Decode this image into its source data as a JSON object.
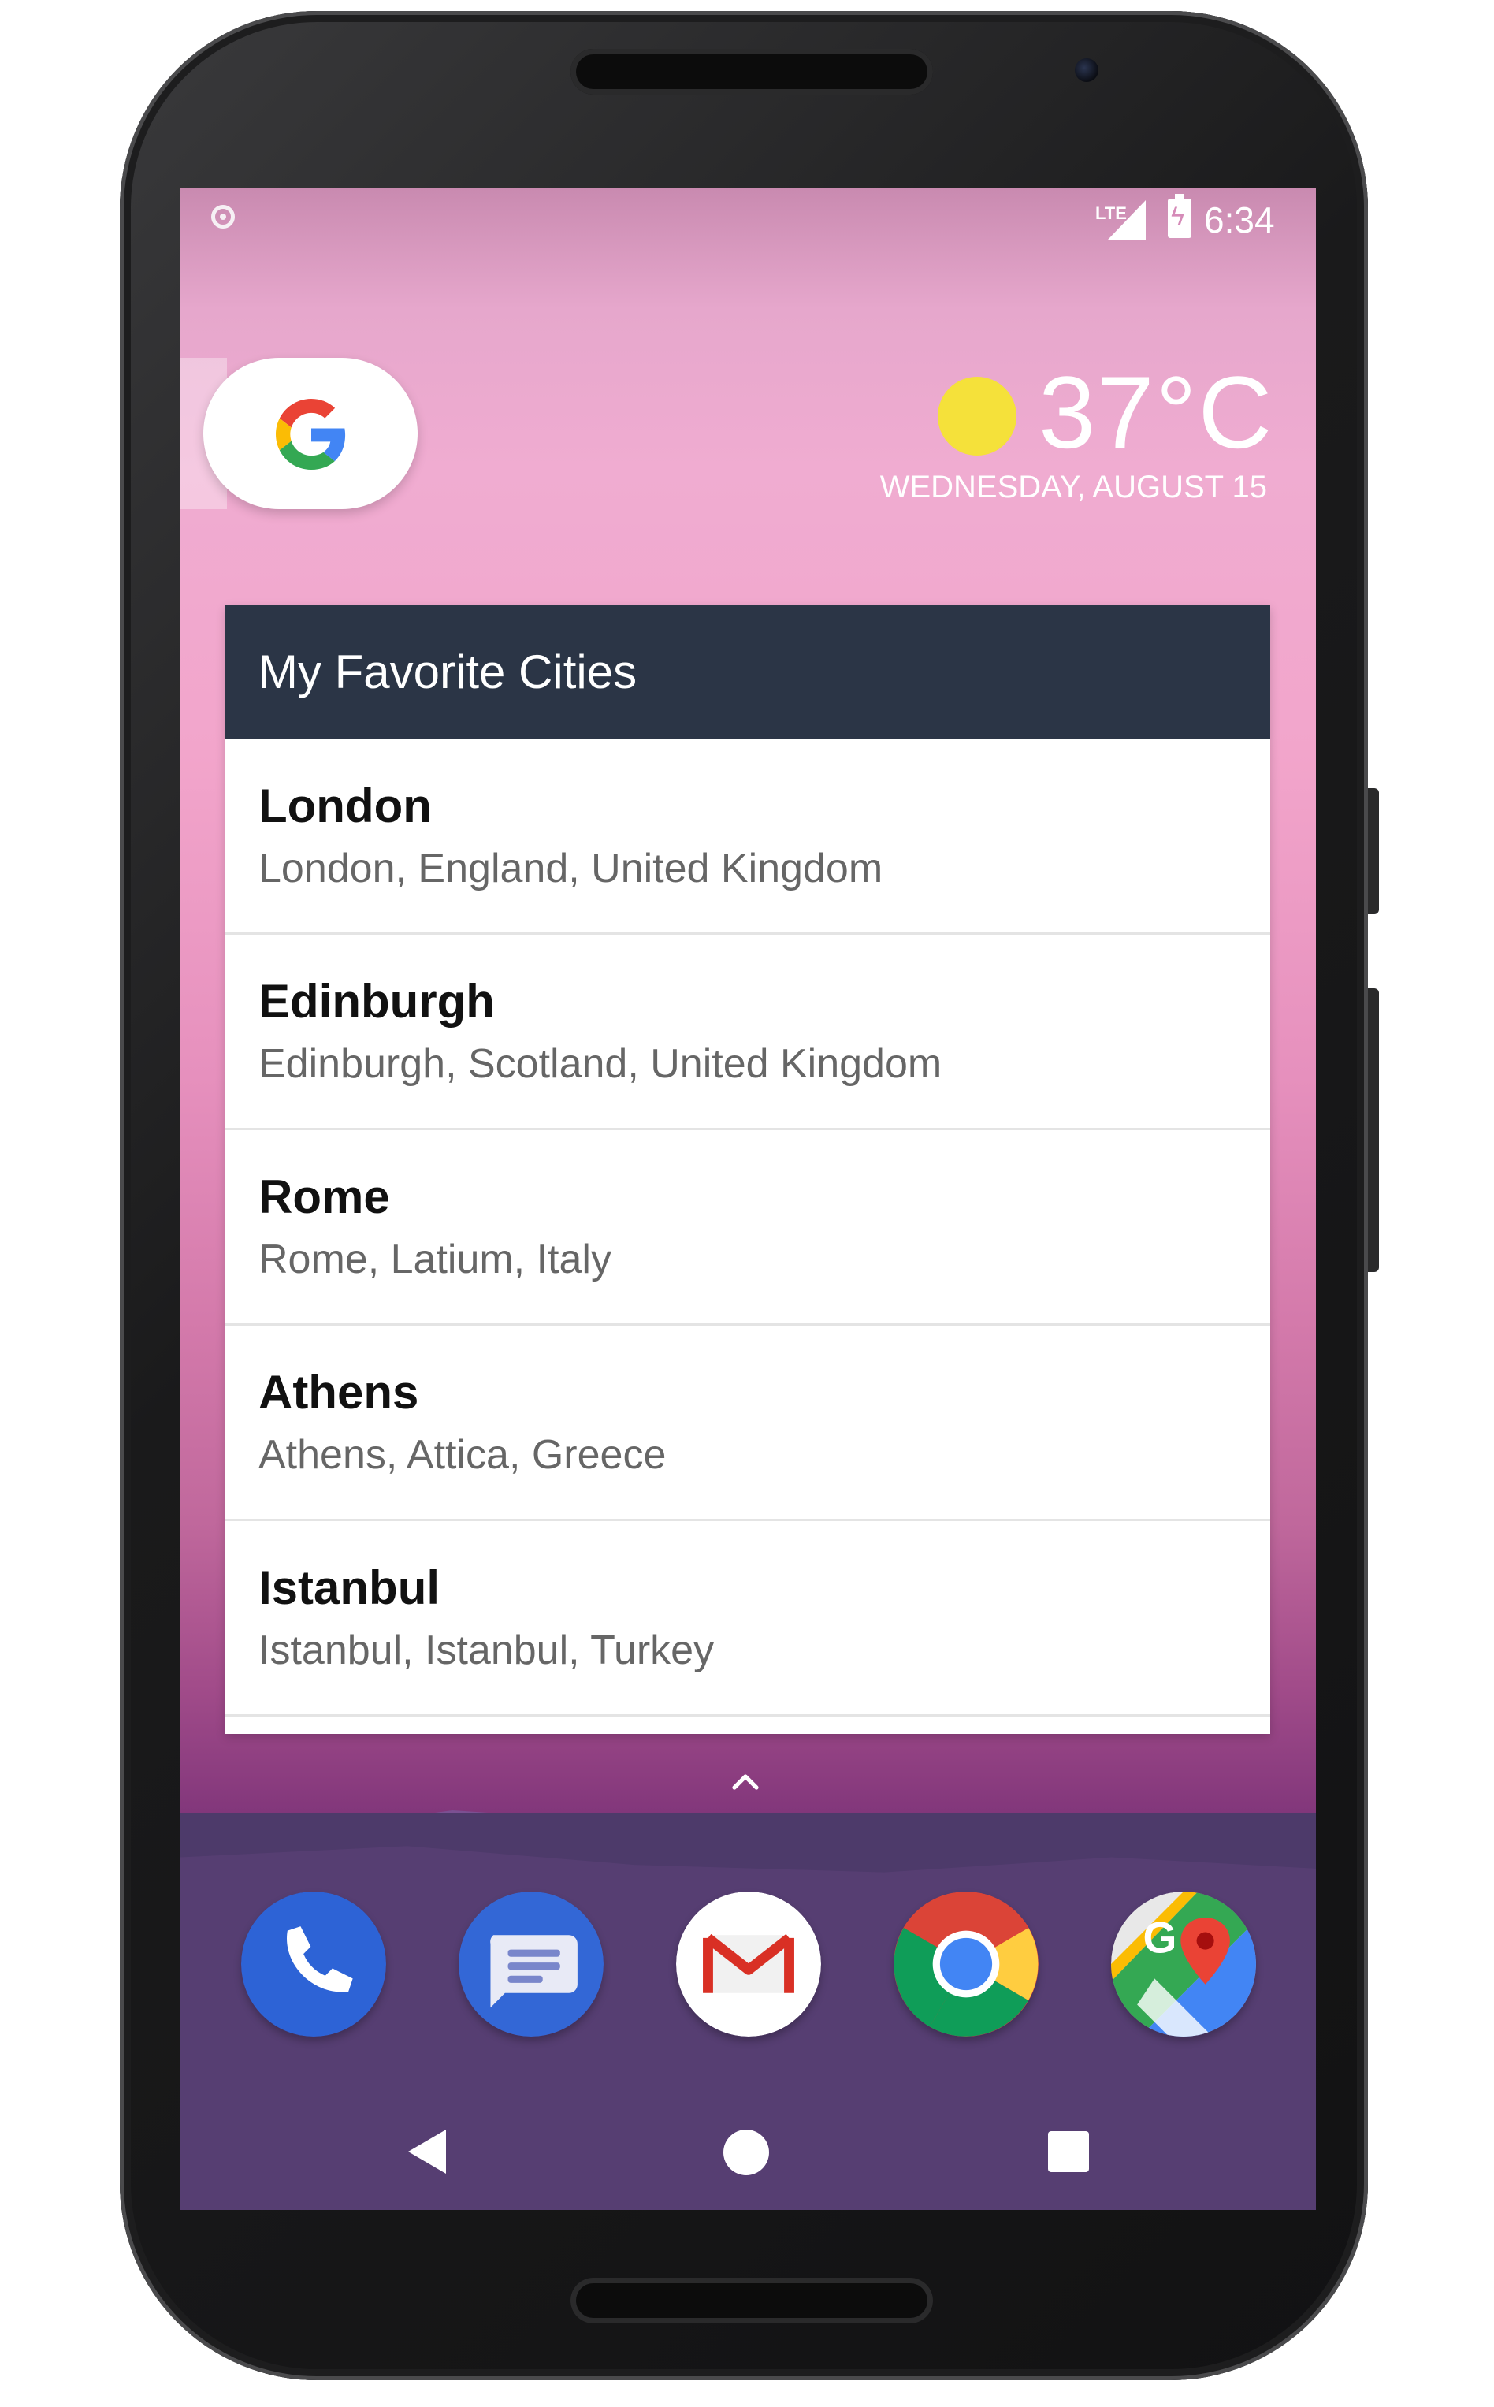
{
  "status_bar": {
    "network": "LTE",
    "time": "6:34"
  },
  "weather": {
    "temperature": "37°C",
    "date": "WEDNESDAY, AUGUST 15",
    "icon": "sun-icon",
    "sun_color": "#f5e13a"
  },
  "search": {
    "icon": "google-g-icon"
  },
  "widget": {
    "title": "My Favorite Cities",
    "header_color": "#2b3546",
    "cities": [
      {
        "name": "London",
        "detail": "London, England, United Kingdom"
      },
      {
        "name": "Edinburgh",
        "detail": "Edinburgh, Scotland, United Kingdom"
      },
      {
        "name": "Rome",
        "detail": "Rome, Latium, Italy"
      },
      {
        "name": "Athens",
        "detail": "Athens, Attica, Greece"
      },
      {
        "name": "Istanbul",
        "detail": "Istanbul, Istanbul, Turkey"
      }
    ]
  },
  "dock": {
    "apps": [
      "phone-icon",
      "messages-icon",
      "gmail-icon",
      "chrome-icon",
      "maps-icon"
    ]
  },
  "navigation": {
    "buttons": [
      "back-icon",
      "home-icon",
      "recents-icon"
    ]
  }
}
